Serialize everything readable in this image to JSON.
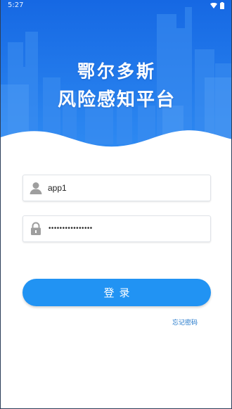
{
  "status_bar": {
    "time": "5:27",
    "wifi_icon": "wifi-icon",
    "battery_icon": "battery-icon"
  },
  "header": {
    "title_line1": "鄂尔多斯",
    "title_line2": "风险感知平台"
  },
  "login_form": {
    "username": {
      "icon": "user-icon",
      "value": "app1"
    },
    "password": {
      "icon": "lock-icon",
      "masked_value": "••••••••••••••••"
    },
    "login_label": "登录",
    "forgot_password_label": "忘记密码"
  },
  "colors": {
    "hero_gradient_top": "#1a6fe6",
    "hero_gradient_bottom": "#2f8af2",
    "button": "#2193f3",
    "link": "#1a73c9"
  }
}
